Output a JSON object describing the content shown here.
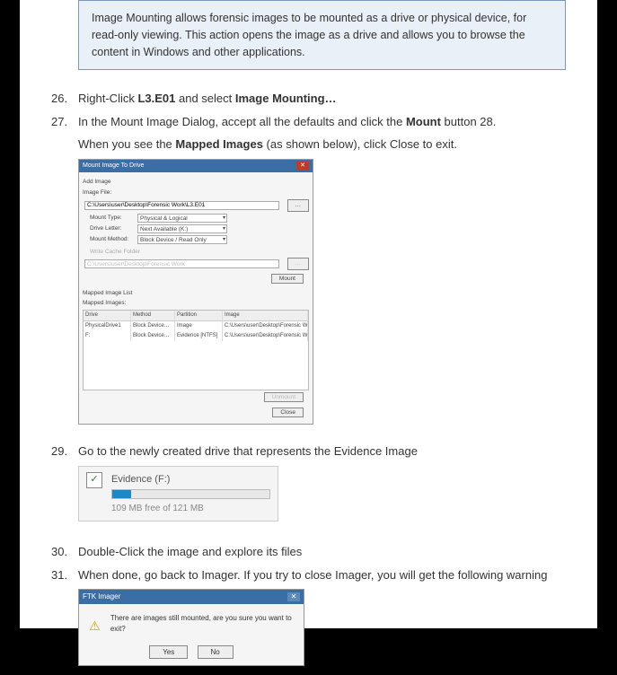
{
  "infobox": "Image Mounting allows forensic images to be mounted as a drive or physical device, for read-only viewing. This action opens the image as a drive and allows you to browse the content in Windows and other applications.",
  "steps": {
    "s26_pre": "Right-Click ",
    "s26_b1": "L3.E01",
    "s26_mid": " and select ",
    "s26_b2": "Image Mounting…",
    "s27_pre": "In the Mount Image Dialog, accept all the defaults and click the ",
    "s27_b1": "Mount",
    "s27_post": " button 28.",
    "s27_sub_pre": "When you see the ",
    "s27_sub_b": "Mapped Images",
    "s27_sub_post": " (as shown below), click Close to exit.",
    "s29": "Go to the newly created drive that represents the Evidence Image",
    "s30": "Double-Click the image and explore its files",
    "s31": "When done, go back to Imager. If you try to close Imager, you will get the following warning"
  },
  "dialog1": {
    "title": "Mount Image To Drive",
    "add_image": "Add Image",
    "image_file_label": "Image File:",
    "image_file_value": "C:\\Users\\user\\Desktop\\Forensic Work\\L3.E01",
    "mount_type_label": "Mount Type:",
    "mount_type_value": "Physical & Logical",
    "drive_letter_label": "Drive Letter:",
    "drive_letter_value": "Next Available (K:)",
    "mount_method_label": "Mount Method:",
    "mount_method_value": "Block Device / Read Only",
    "write_cache_label": "Write Cache Folder",
    "write_cache_value": "C:\\Users\\user\\Desktop\\Forensic Work",
    "mount_btn": "Mount",
    "mapped_list": "Mapped Image List",
    "mapped_images": "Mapped Images:",
    "col1": "Drive",
    "col2": "Method",
    "col3": "Partition",
    "col4": "Image",
    "r1c1": "PhysicalDrive1",
    "r1c2": "Block Device…",
    "r1c3": "Image",
    "r1c4": "C:\\Users\\user\\Desktop\\Forensic Wo…",
    "r2c1": "F:",
    "r2c2": "Block Device…",
    "r2c3": "Evidence [NTFS]",
    "r2c4": "C:\\Users\\user\\Desktop\\Forensic Wo…",
    "unmount_btn": "Unmount",
    "close_btn": "Close"
  },
  "drive": {
    "check": "✓",
    "label": "Evidence (F:)",
    "sub": "109 MB free of 121 MB"
  },
  "dialog2": {
    "title": "FTK Imager",
    "warn_glyph": "⚠",
    "message": "There are images still mounted, are you sure you want to exit?",
    "yes": "Yes",
    "no": "No"
  }
}
